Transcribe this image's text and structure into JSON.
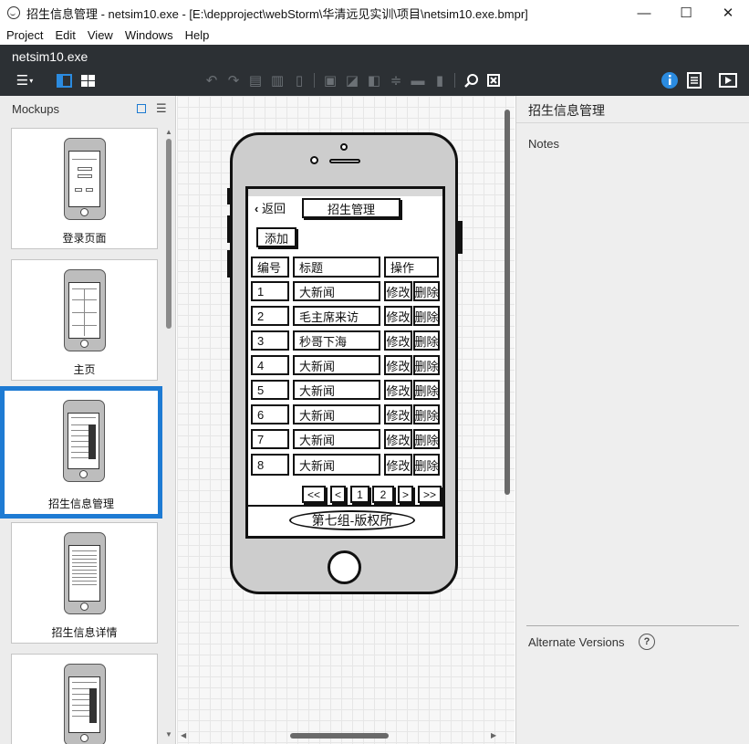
{
  "window": {
    "title": "招生信息管理 - netsim10.exe - [E:\\depproject\\webStorm\\华清远见实训\\项目\\netsim10.exe.bmpr]",
    "minimize": "—",
    "maximize": "☐",
    "close": "✕"
  },
  "menu": [
    "Project",
    "Edit",
    "View",
    "Windows",
    "Help"
  ],
  "toolbar": {
    "project_name": "netsim10.exe",
    "icons": [
      "hamburger-icon",
      "split-view-icon",
      "grid-view-icon",
      "undo-icon",
      "redo-icon",
      "copy-icon",
      "paste-icon",
      "clipboard-icon",
      "group-icon",
      "ungroup-icon",
      "arrange-icon",
      "align-icon",
      "lock-icon",
      "trash-icon",
      "search-icon",
      "clear-icon",
      "info-icon",
      "list-icon",
      "present-icon"
    ]
  },
  "mockups_panel": {
    "title": "Mockups",
    "items": [
      {
        "label": "登录页面"
      },
      {
        "label": "主页"
      },
      {
        "label": "招生信息管理",
        "selected": true
      },
      {
        "label": "招生信息详情"
      },
      {
        "label": ""
      }
    ]
  },
  "mockup": {
    "back_label": "返回",
    "header_title": "招生管理",
    "add_button": "添加",
    "table_headers": [
      "编号",
      "标题",
      "操作"
    ],
    "rows": [
      {
        "id": "1",
        "title": "大新闻"
      },
      {
        "id": "2",
        "title": "毛主席来访"
      },
      {
        "id": "3",
        "title": "秒哥下海"
      },
      {
        "id": "4",
        "title": "大新闻"
      },
      {
        "id": "5",
        "title": "大新闻"
      },
      {
        "id": "6",
        "title": "大新闻"
      },
      {
        "id": "7",
        "title": "大新闻"
      },
      {
        "id": "8",
        "title": "大新闻"
      }
    ],
    "edit_label": "修改",
    "delete_label": "删除",
    "pagination": [
      "<<",
      "<",
      "1",
      "2",
      ">",
      ">>"
    ],
    "footer": "第七组-版权所"
  },
  "properties_panel": {
    "title": "招生信息管理",
    "notes_label": "Notes",
    "alternate_versions_label": "Alternate Versions",
    "help": "?"
  }
}
